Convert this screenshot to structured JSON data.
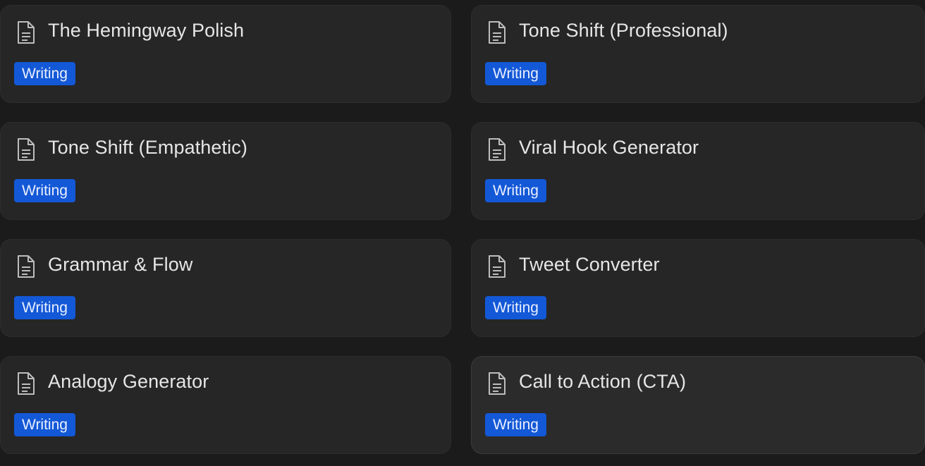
{
  "colors": {
    "background": "#1b1b1b",
    "card_background": "#262626",
    "title_text": "#e6e6e6",
    "tag_background": "#1358d6",
    "tag_text": "#e9efff",
    "icon_stroke": "#bdbdbd"
  },
  "cards": [
    {
      "title": "The Hemingway Polish",
      "tag": "Writing",
      "icon": "document-icon"
    },
    {
      "title": "Tone Shift (Professional)",
      "tag": "Writing",
      "icon": "document-icon"
    },
    {
      "title": "Tone Shift (Empathetic)",
      "tag": "Writing",
      "icon": "document-icon"
    },
    {
      "title": "Viral Hook Generator",
      "tag": "Writing",
      "icon": "document-icon"
    },
    {
      "title": "Grammar & Flow",
      "tag": "Writing",
      "icon": "document-icon"
    },
    {
      "title": "Tweet Converter",
      "tag": "Writing",
      "icon": "document-icon"
    },
    {
      "title": "Analogy Generator",
      "tag": "Writing",
      "icon": "document-icon"
    },
    {
      "title": "Call to Action (CTA)",
      "tag": "Writing",
      "icon": "document-icon"
    }
  ]
}
